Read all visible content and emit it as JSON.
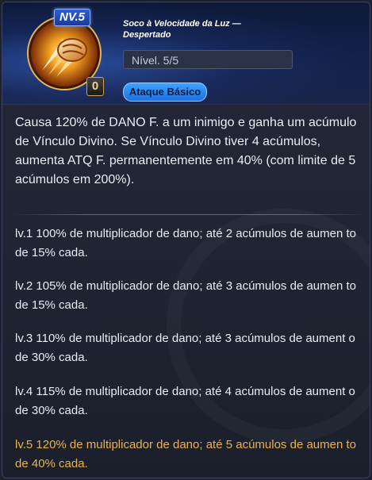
{
  "skill": {
    "level_badge": "NV.5",
    "cost": "0",
    "name": "Soco à Velocidade da Luz — Despertado",
    "level_text": "Nível. 5/5",
    "type": "Ataque Básico"
  },
  "description": "Causa 120% de DANO F. a um inimigo e ganha um acúmulo de Vínculo Divino. Se Vínculo Divino tiver 4 acúmulos, aumenta ATQ F. permanentemente em 40% (com limite de 5 acúmulos em 200%).",
  "levels": [
    "lv.1 100% de multiplicador de dano; até 2 acúmulos de aumen to de 15% cada.",
    "lv.2 105% de multiplicador de dano; até 3 acúmulos de aumen to de 15% cada.",
    "lv.3 110% de multiplicador de dano; até 3 acúmulos de aument o de 30% cada.",
    "lv.4 115% de multiplicador de dano; até 4 acúmulos de aument o de 30% cada.",
    "lv.5 120% de multiplicador de dano; até 5 acúmulos de aumen to de 40% cada."
  ],
  "colors": {
    "active_level": "#e9b24f",
    "type_chip": "#2f8cf0"
  }
}
